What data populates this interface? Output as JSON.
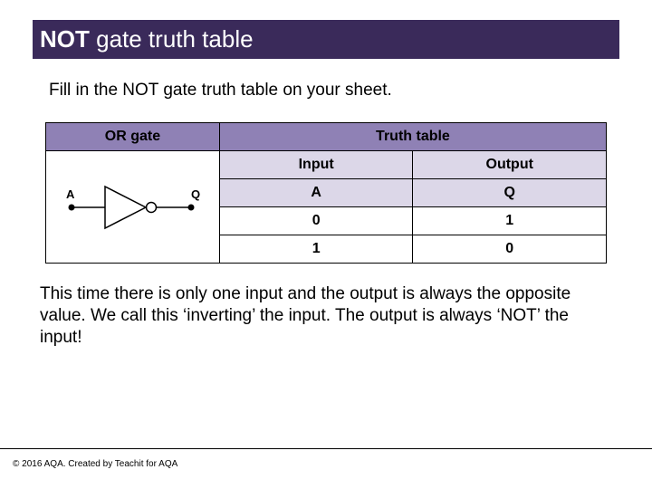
{
  "title": {
    "prefix": "NOT ",
    "rest": "gate truth table"
  },
  "instruction": "Fill in the NOT gate truth table on your sheet.",
  "table": {
    "gate_header": "OR gate",
    "truth_header": "Truth table",
    "input_header": "Input",
    "output_header": "Output",
    "column_a": "A",
    "column_q": "Q",
    "rows": [
      {
        "a": "0",
        "q": "1"
      },
      {
        "a": "1",
        "q": "0"
      }
    ],
    "gate_labels": {
      "input": "A",
      "output": "Q"
    }
  },
  "explanation": "This time there is only one input and the output is always the opposite value. We call this ‘inverting’ the input. The output is always ‘NOT’ the input!",
  "copyright": "© 2016 AQA. Created by Teachit for AQA",
  "chart_data": {
    "type": "table",
    "title": "NOT gate truth table",
    "columns": [
      "Input A",
      "Output Q"
    ],
    "rows": [
      [
        0,
        1
      ],
      [
        1,
        0
      ]
    ]
  }
}
